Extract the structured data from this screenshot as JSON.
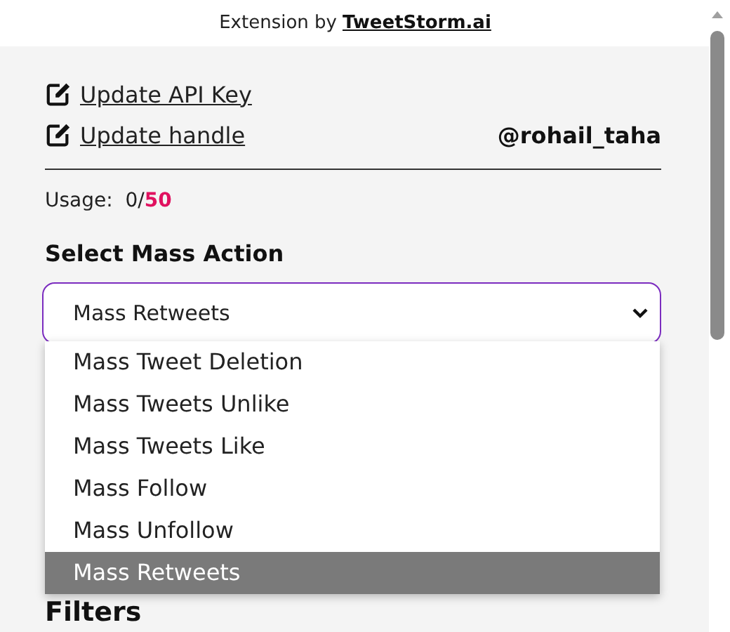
{
  "header": {
    "prefix": "Extension by",
    "brand": "TweetStorm.ai"
  },
  "links": [
    {
      "label": "Update API Key"
    },
    {
      "label": "Update handle"
    }
  ],
  "handle": "@rohail_taha",
  "usage": {
    "label": "Usage:",
    "used": "0/",
    "limit": "50"
  },
  "mass_action": {
    "label": "Select Mass Action",
    "value": "Mass Retweets",
    "options": [
      {
        "label": "Mass Tweet Deletion",
        "selected": false
      },
      {
        "label": "Mass Tweets Unlike",
        "selected": false
      },
      {
        "label": "Mass Tweets Like",
        "selected": false
      },
      {
        "label": "Mass Follow",
        "selected": false
      },
      {
        "label": "Mass Unfollow",
        "selected": false
      },
      {
        "label": "Mass Retweets",
        "selected": true
      }
    ]
  },
  "filters_heading": "Filters"
}
